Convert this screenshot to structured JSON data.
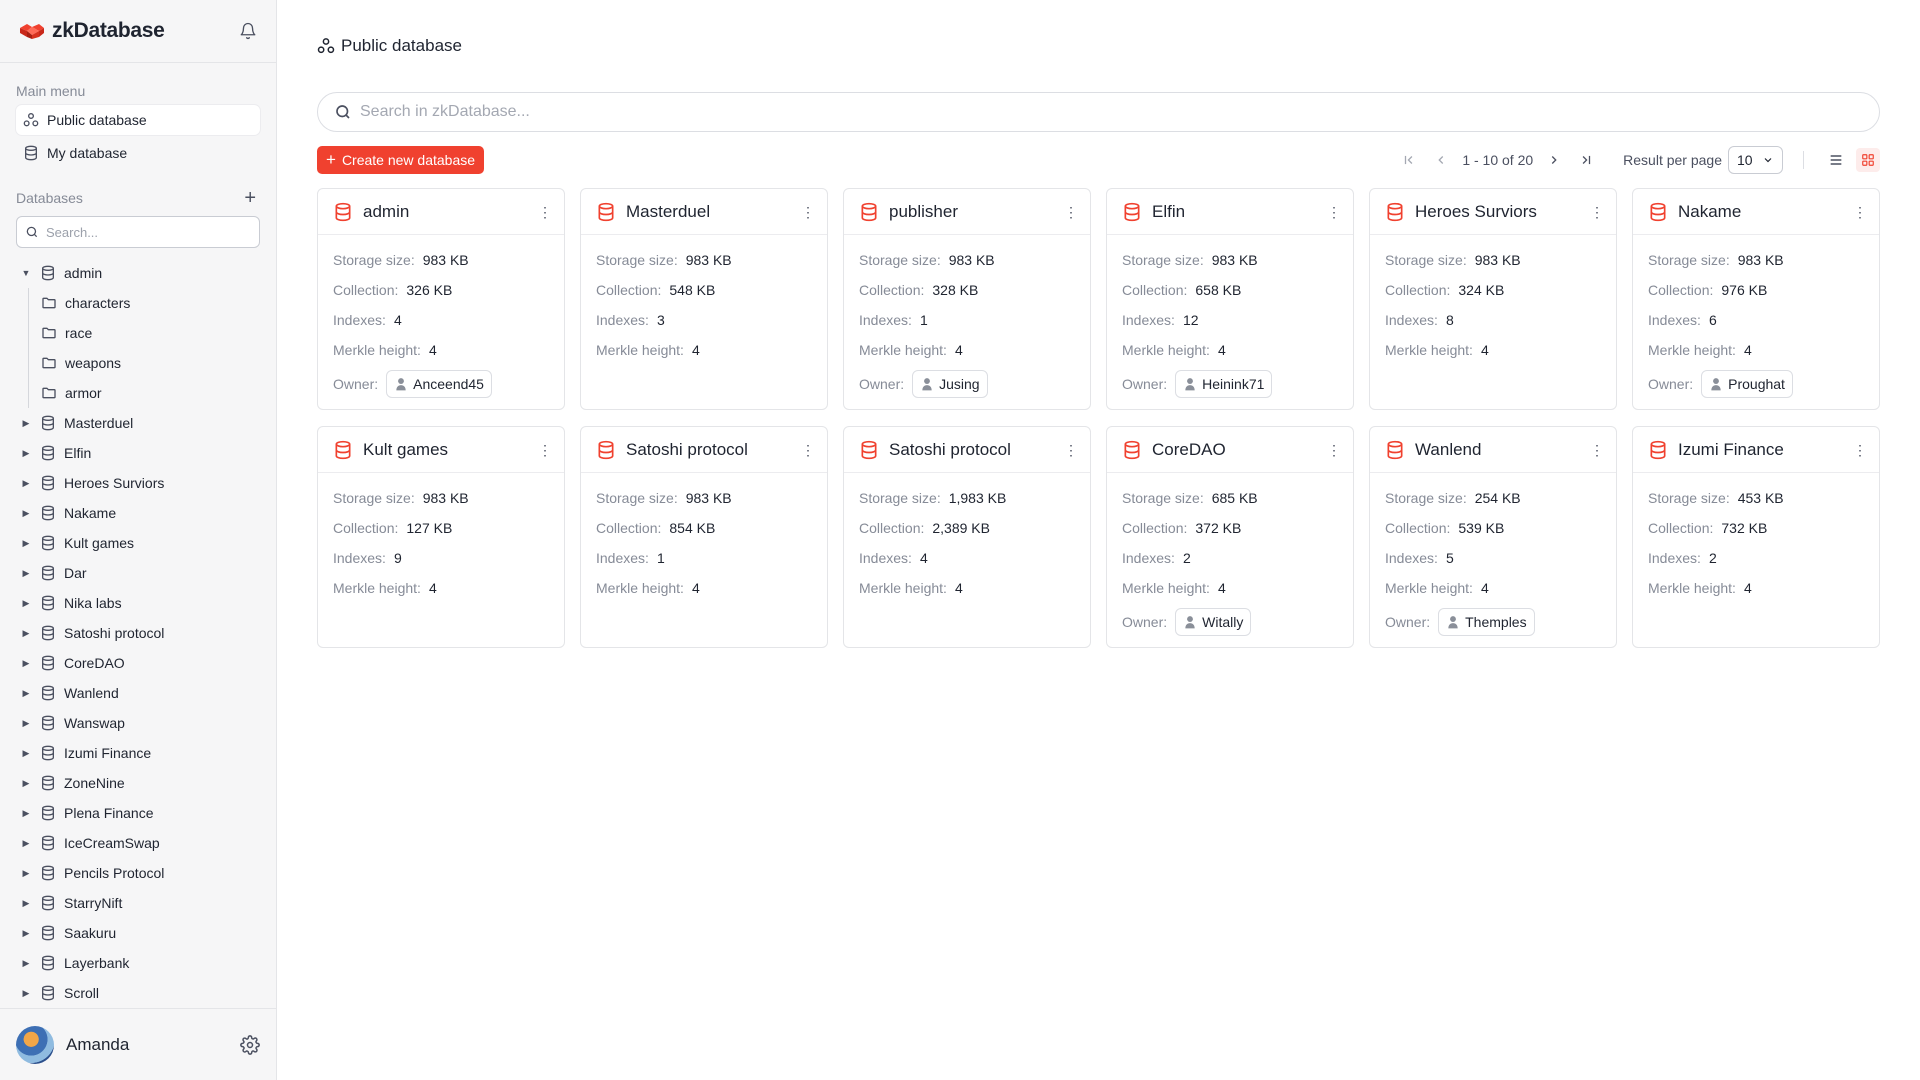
{
  "brand": {
    "name": "zkDatabase"
  },
  "sidebar": {
    "main_menu_title": "Main menu",
    "menu": [
      {
        "label": "Public database",
        "active": true
      },
      {
        "label": "My database",
        "active": false
      }
    ],
    "databases_title": "Databases",
    "search_placeholder": "Search...",
    "tree": [
      {
        "label": "admin",
        "expanded": true,
        "children": [
          "characters",
          "race",
          "weapons",
          "armor"
        ]
      },
      {
        "label": "Masterduel"
      },
      {
        "label": "Elfin"
      },
      {
        "label": "Heroes Surviors"
      },
      {
        "label": "Nakame"
      },
      {
        "label": "Kult games"
      },
      {
        "label": "Dar"
      },
      {
        "label": "Nika labs"
      },
      {
        "label": "Satoshi protocol"
      },
      {
        "label": "CoreDAO"
      },
      {
        "label": "Wanlend"
      },
      {
        "label": "Wanswap"
      },
      {
        "label": "Izumi Finance"
      },
      {
        "label": "ZoneNine"
      },
      {
        "label": "Plena Finance"
      },
      {
        "label": "IceCreamSwap"
      },
      {
        "label": "Pencils Protocol"
      },
      {
        "label": "StarryNift"
      },
      {
        "label": "Saakuru"
      },
      {
        "label": "Layerbank"
      },
      {
        "label": "Scroll"
      }
    ],
    "user": {
      "name": "Amanda"
    }
  },
  "main": {
    "title": "Public database",
    "search_placeholder": "Search in zkDatabase...",
    "create_label": "Create new database",
    "pagination": {
      "range": "1 - 10 of 20",
      "per_page_label": "Result per page",
      "per_page": "10"
    },
    "labels": {
      "storage": "Storage size:",
      "collection": "Collection:",
      "indexes": "Indexes:",
      "merkle": "Merkle height:",
      "owner": "Owner:"
    },
    "cards": [
      {
        "name": "admin",
        "storage": "983 KB",
        "collection": "326 KB",
        "indexes": "4",
        "merkle": "4",
        "owner": "Anceend45"
      },
      {
        "name": "Masterduel",
        "storage": "983 KB",
        "collection": "548 KB",
        "indexes": "3",
        "merkle": "4",
        "owner": null
      },
      {
        "name": "publisher",
        "storage": "983 KB",
        "collection": "328 KB",
        "indexes": "1",
        "merkle": "4",
        "owner": "Jusing"
      },
      {
        "name": "Elfin",
        "storage": "983 KB",
        "collection": "658 KB",
        "indexes": "12",
        "merkle": "4",
        "owner": "Heinink71"
      },
      {
        "name": "Heroes Surviors",
        "storage": "983 KB",
        "collection": "324 KB",
        "indexes": "8",
        "merkle": "4",
        "owner": null
      },
      {
        "name": "Nakame",
        "storage": "983 KB",
        "collection": "976 KB",
        "indexes": "6",
        "merkle": "4",
        "owner": "Proughat"
      },
      {
        "name": "Kult games",
        "storage": "983 KB",
        "collection": "127 KB",
        "indexes": "9",
        "merkle": "4",
        "owner": null
      },
      {
        "name": "Satoshi protocol",
        "storage": "983 KB",
        "collection": "854 KB",
        "indexes": "1",
        "merkle": "4",
        "owner": null
      },
      {
        "name": "Satoshi protocol",
        "storage": "1,983 KB",
        "collection": "2,389 KB",
        "indexes": "4",
        "merkle": "4",
        "owner": null
      },
      {
        "name": "CoreDAO",
        "storage": "685 KB",
        "collection": "372 KB",
        "indexes": "2",
        "merkle": "4",
        "owner": "Witally"
      },
      {
        "name": "Wanlend",
        "storage": "254 KB",
        "collection": "539 KB",
        "indexes": "5",
        "merkle": "4",
        "owner": "Themples"
      },
      {
        "name": "Izumi Finance",
        "storage": "453 KB",
        "collection": "732 KB",
        "indexes": "2",
        "merkle": "4",
        "owner": null
      }
    ]
  },
  "colors": {
    "accent": "#f0412f",
    "sidebar_bg": "#f6f6f7",
    "border": "#e4e5e8",
    "muted_text": "#868b97"
  },
  "icons": {
    "brand": "zkdatabase-logo",
    "bell": "bell-icon",
    "public_db": "nodes-icon",
    "my_db": "database-icon",
    "add": "plus-icon",
    "search": "search-icon",
    "folder": "folder-icon",
    "gear": "gear-icon",
    "list_view": "list-icon",
    "grid_view": "grid-icon",
    "user": "user-icon"
  }
}
